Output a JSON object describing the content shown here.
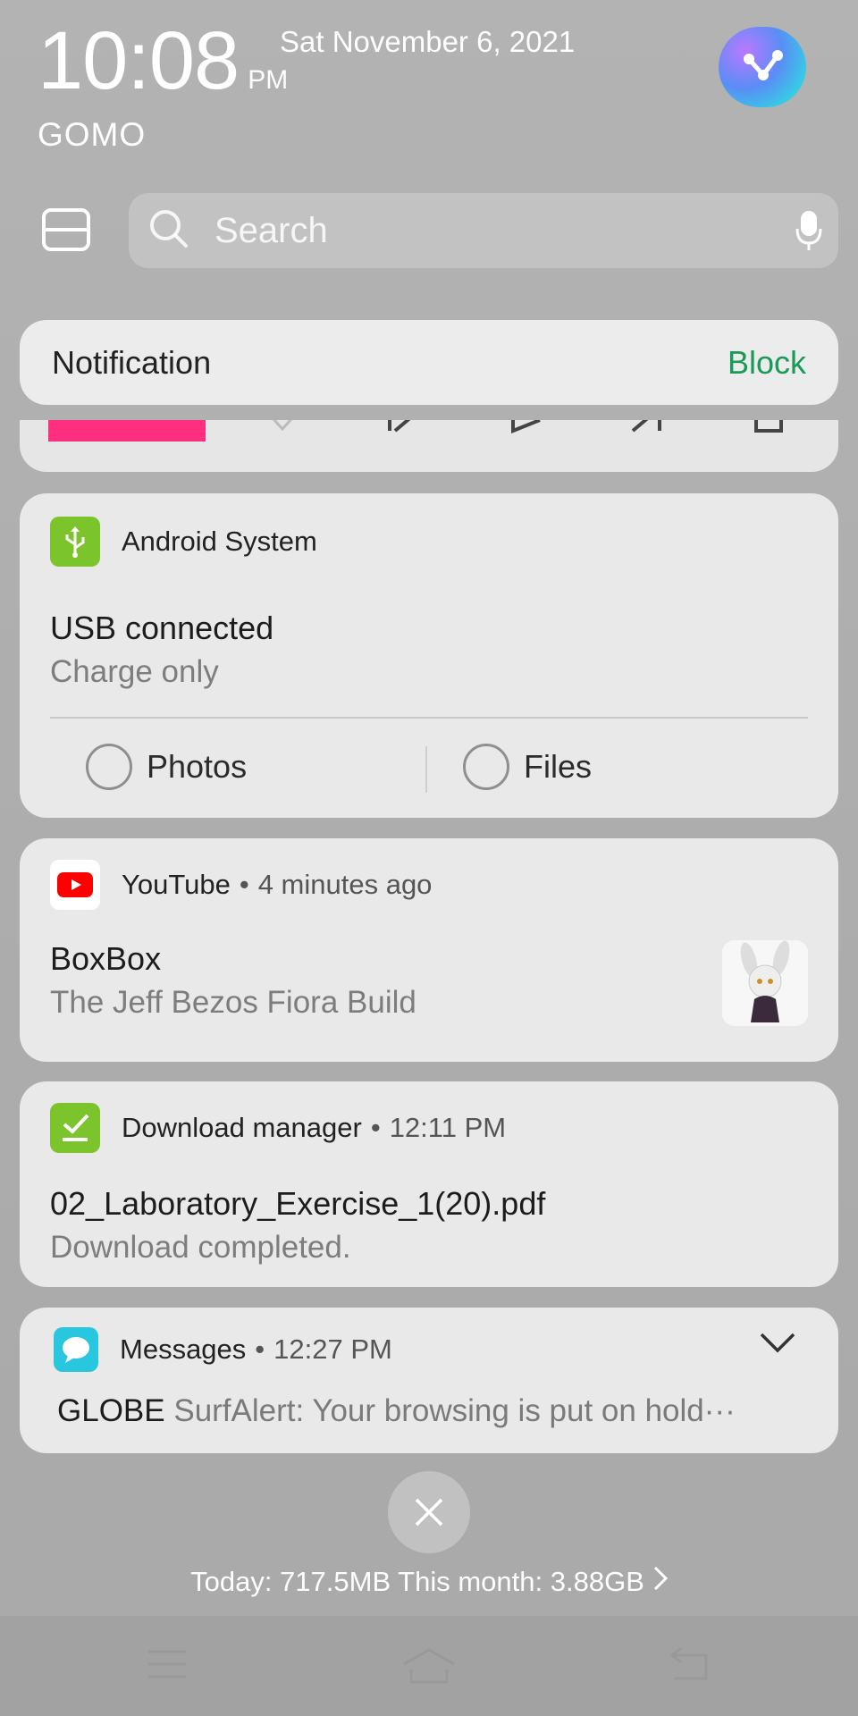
{
  "status": {
    "time": "10:08",
    "ampm": "PM",
    "date": "Sat November 6, 2021",
    "carrier": "GOMO"
  },
  "search": {
    "placeholder": "Search"
  },
  "notification_bar": {
    "label": "Notification",
    "block_label": "Block",
    "block_color": "#1a9a56"
  },
  "notifications": {
    "android": {
      "app": "Android System",
      "title": "USB connected",
      "subtitle": "Charge only",
      "options": [
        "Photos",
        "Files"
      ],
      "icon": "usb-icon",
      "icon_color": "#7cc42c"
    },
    "youtube": {
      "app": "YouTube",
      "time": "4 minutes ago",
      "title": "BoxBox",
      "subtitle": "The Jeff Bezos Fiora Build",
      "icon": "youtube-icon",
      "icon_color": "#ff0000"
    },
    "download": {
      "app": "Download manager",
      "time": "12:11 PM",
      "title": "02_Laboratory_Exercise_1(20).pdf",
      "subtitle": "Download completed.",
      "icon": "download-check-icon",
      "icon_color": "#7cc42c"
    },
    "messages": {
      "app": "Messages",
      "time": "12:27 PM",
      "sender": "GLOBE",
      "preview": "SurfAlert: Your browsing is put on hold",
      "ellipsis": "···",
      "icon": "chat-bubble-icon",
      "icon_color": "#29c6e0"
    }
  },
  "data_usage": {
    "text": "Today: 717.5MB This month: 3.88GB"
  },
  "accent_colors": {
    "media_progress": "#ff2f7f"
  }
}
